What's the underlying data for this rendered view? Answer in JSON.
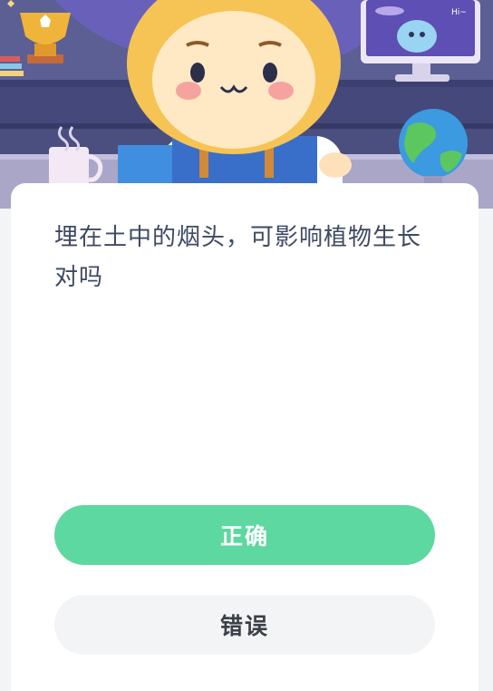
{
  "question": {
    "text": "埋在土中的烟头，可影响植物生长对吗"
  },
  "answers": {
    "correct_label": "正确",
    "wrong_label": "错误"
  },
  "banner": {
    "bubble_text": "Hi~"
  },
  "colors": {
    "correct_button": "#5dd8a0",
    "wrong_button": "#f3f4f6",
    "question_text": "#3d4a63",
    "banner_bg": "#4a4f7e"
  }
}
